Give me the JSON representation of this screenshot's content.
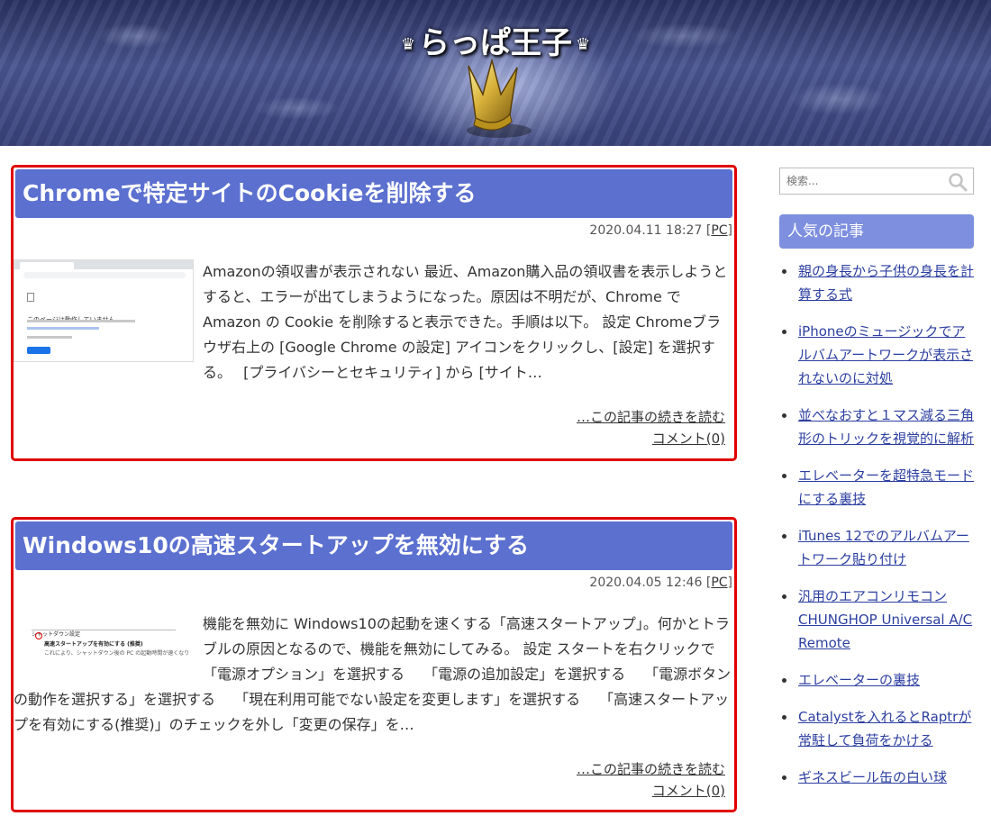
{
  "site": {
    "title": "らっぱ王子",
    "crown_glyph": "♛"
  },
  "articles": [
    {
      "title": "Chromeで特定サイトのCookieを削除する",
      "date": "2020.04.11 18:27",
      "category": "PC",
      "thumb_text": "このページは動作していません",
      "excerpt": "Amazonの領収書が表示されない 最近、Amazon購入品の領収書を表示しようとすると、エラーが出てしまうようになった。原因は不明だが、Chrome で Amazon の Cookie を削除すると表示できた。手順は以下。 設定 Chromeブラウザ右上の [Google Chrome の設定] アイコンをクリックし、[設定] を選択する。　 [プライバシーとセキュリティ] から [サイト…",
      "read_more": "…この記事の続きを読む",
      "comment": "コメント(0)"
    },
    {
      "title": "Windows10の高速スタートアップを無効にする",
      "date": "2020.04.05 12:46",
      "category": "PC",
      "thumb_title": "シャットダウン設定",
      "thumb_line1": "高速スタートアップを有効にする (推奨)",
      "thumb_line2": "これにより、シャットダウン後の PC の起動時間が速くなります。",
      "excerpt": "機能を無効に Windows10の起動を速くする「高速スタートアップ」。何かとトラブルの原因となるので、機能を無効にしてみる。 設定 スタートを右クリックで「電源オプション」を選択する　 「電源の追加設定」を選択する　 「電源ボタンの動作を選択する」を選択する　 「現在利用可能でない設定を変更します」を選択する　 「高速スタートアップを有効にする(推奨)」のチェックを外し「変更の保存」を…",
      "read_more": "…この記事の続きを読む",
      "comment": "コメント(0)"
    }
  ],
  "sidebar": {
    "search_placeholder": "検索...",
    "popular_title": "人気の記事",
    "popular_items": [
      "親の身長から子供の身長を計算する式",
      "iPhoneのミュージックでアルバムアートワークが表示されないのに対処",
      "並べなおすと１マス減る三角形のトリックを視覚的に解析",
      "エレベーターを超特急モードにする裏技",
      "iTunes 12でのアルバムアートワーク貼り付け",
      "汎用のエアコンリモコン CHUNGHOP Universal A/C Remote",
      "エレベーターの裏技",
      "Catalystを入れるとRaptrが常駐して負荷をかける",
      "ギネスビール缶の白い球"
    ]
  },
  "colors": {
    "title_bar": "#5b70cf",
    "card_border": "#e00000",
    "sidebar_header": "#7d8fde"
  }
}
